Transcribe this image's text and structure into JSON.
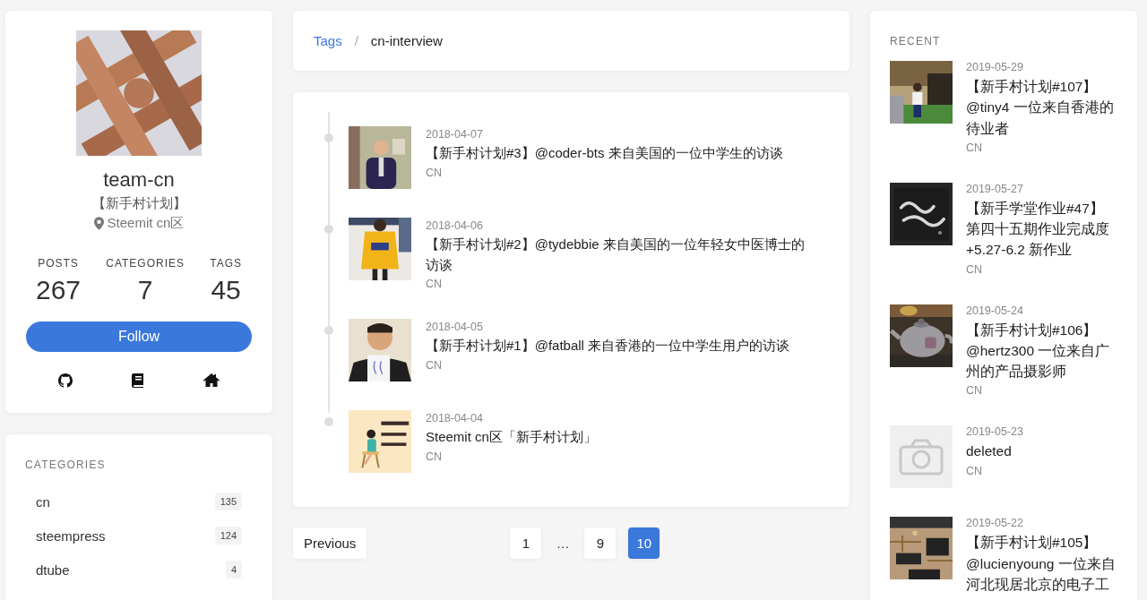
{
  "profile": {
    "kind": "picture",
    "name": "team-cn",
    "subtitle": "【新手村计划】",
    "location": "Steemit cn区",
    "stats": [
      {
        "label": "POSTS",
        "value": "267"
      },
      {
        "label": "CATEGORIES",
        "value": "7"
      },
      {
        "label": "TAGS",
        "value": "45"
      }
    ],
    "follow_button": "Follow"
  },
  "categories": {
    "title": "CATEGORIES",
    "items": [
      {
        "name": "cn",
        "count": "135"
      },
      {
        "name": "steempress",
        "count": "124"
      },
      {
        "name": "dtube",
        "count": "4"
      }
    ]
  },
  "breadcrumb": {
    "separator": "/",
    "items": [
      {
        "label": "Tags",
        "kind": "link"
      },
      {
        "label": "cn-interview",
        "kind": "current"
      }
    ]
  },
  "posts": [
    {
      "kind": "picture",
      "date": "2018-04-07",
      "title": "【新手村计划#3】@coder-bts 来自美国的一位中学生的访谈",
      "category": "CN"
    },
    {
      "kind": "picture",
      "date": "2018-04-06",
      "title": "【新手村计划#2】@tydebbie 来自美国的一位年轻女中医博士的访谈",
      "category": "CN"
    },
    {
      "kind": "picture",
      "date": "2018-04-05",
      "title": "【新手村计划#1】@fatball 来自香港的一位中学生用户的访谈",
      "category": "CN"
    },
    {
      "kind": "picture",
      "date": "2018-04-04",
      "title": "Steemit cn区「新手村计划」",
      "category": "CN"
    }
  ],
  "pagination": {
    "previous": "Previous",
    "pages": [
      {
        "kind": "page",
        "label": "1",
        "selected": false
      },
      {
        "kind": "gap",
        "label": "…"
      },
      {
        "kind": "page",
        "label": "9",
        "selected": false
      },
      {
        "kind": "page",
        "label": "10",
        "selected": true
      }
    ]
  },
  "recent": {
    "title": "RECENT",
    "items": [
      {
        "kind": "picture",
        "date": "2019-05-29",
        "title": "【新手村计划#107】@tiny4 一位来自香港的待业者",
        "category": "CN"
      },
      {
        "kind": "picture",
        "date": "2019-05-27",
        "title": "【新手学堂作业#47】第四十五期作业完成度+5.27-6.2 新作业",
        "category": "CN"
      },
      {
        "kind": "picture",
        "date": "2019-05-24",
        "title": "【新手村计划#106】@hertz300 一位来自广州的产品摄影师",
        "category": "CN"
      },
      {
        "kind": "placeholder",
        "date": "2019-05-23",
        "title": "deleted",
        "category": "CN"
      },
      {
        "kind": "picture",
        "date": "2019-05-22",
        "title": "【新手村计划#105】@lucienyoung 一位来自河北现居北京的电子工"
      }
    ]
  }
}
